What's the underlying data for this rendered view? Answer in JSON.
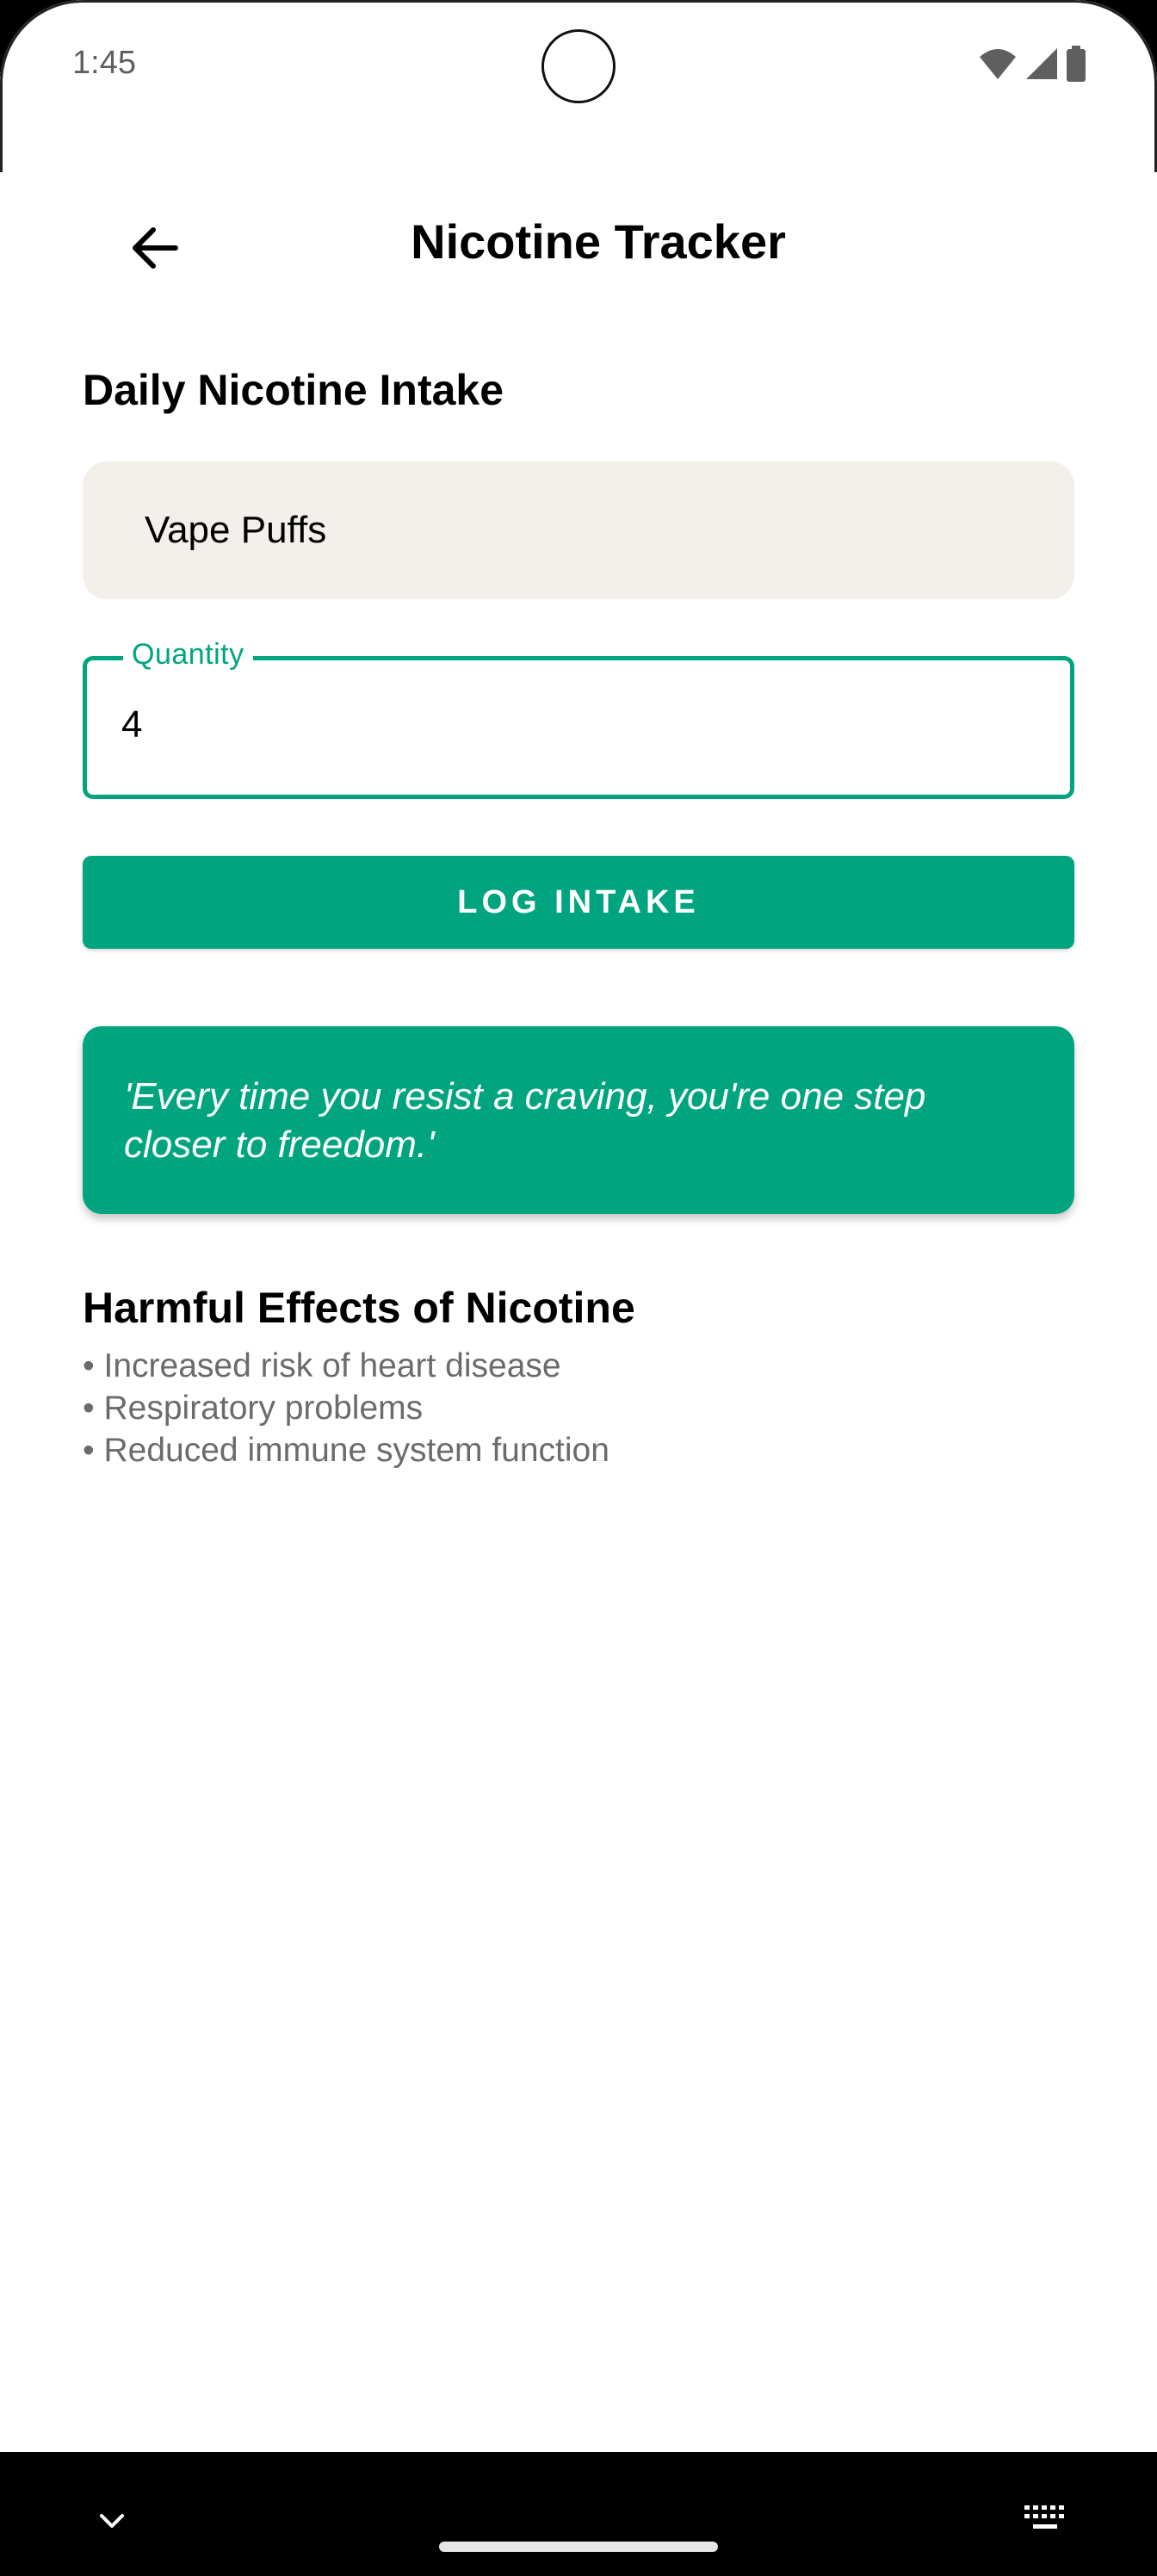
{
  "status_bar": {
    "time": "1:45"
  },
  "app_bar": {
    "title": "Nicotine Tracker",
    "back_icon": "arrow-left-icon"
  },
  "intake": {
    "section_title": "Daily Nicotine Intake",
    "selected_type": "Vape Puffs",
    "quantity_label": "Quantity",
    "quantity_value": "4",
    "log_button_label": "LOG INTAKE"
  },
  "quote": "'Every time you resist a craving, you're one step closer to freedom.'",
  "effects": {
    "title": "Harmful Effects of Nicotine",
    "items": [
      "• Increased risk of heart disease",
      "• Respiratory problems",
      "• Reduced immune system function"
    ]
  },
  "colors": {
    "accent": "#00a57f",
    "select_bg": "#f3efeb",
    "muted_text": "#6b6b6b"
  }
}
